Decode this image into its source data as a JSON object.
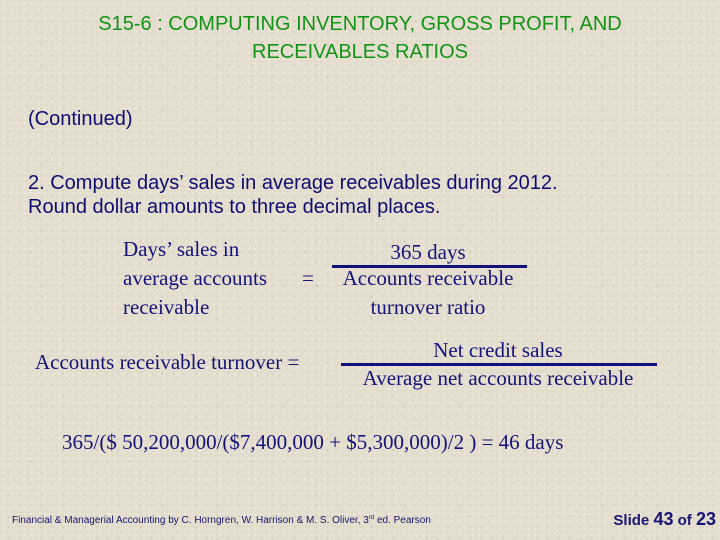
{
  "title": {
    "line1": "S15-6 : COMPUTING INVENTORY, GROSS PROFIT, AND",
    "line2": "RECEIVABLES RATIOS"
  },
  "continued": "(Continued)",
  "question": {
    "line1": "2. Compute days’ sales in average receivables during 2012.",
    "line2": "Round dollar amounts to three decimal places."
  },
  "formula_days_sales": {
    "lhs": [
      "Days’ sales in",
      "average accounts",
      "receivable"
    ],
    "equals": "=",
    "numerator": "365 days",
    "denominator": [
      "Accounts receivable",
      "turnover ratio"
    ]
  },
  "formula_turnover": {
    "lhs": "Accounts receivable turnover =",
    "numerator": "Net credit sales",
    "denominator": "Average net accounts receivable"
  },
  "calculation": "365/($ 50,200,000/($7,400,000 + $5,300,000)/2 ) = 46 days",
  "footer": {
    "credit_before_sup": "Financial & Managerial Accounting by C. Horngren, W. Harrison & M. S. Oliver, 3",
    "credit_sup": "rd",
    "credit_after_sup": " ed. Pearson",
    "slide_label": "Slide ",
    "slide_number": "43",
    "slide_of": " of ",
    "slide_total": "23"
  },
  "colors": {
    "title": "#119416",
    "body": "#0e0e70",
    "background": "#e4dccd"
  }
}
